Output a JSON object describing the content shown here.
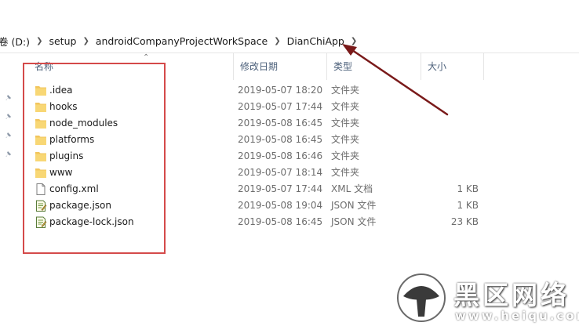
{
  "breadcrumb": [
    {
      "label": "卷 (D:)"
    },
    {
      "label": "setup"
    },
    {
      "label": "androidCompanyProjectWorkSpace"
    },
    {
      "label": "DianChiApp"
    }
  ],
  "columns": {
    "name": "名称",
    "date": "修改日期",
    "type": "类型",
    "size": "大小"
  },
  "files": [
    {
      "name": ".idea",
      "date": "2019-05-07 18:20",
      "type": "文件夹",
      "size": "",
      "icon": "folder-icon"
    },
    {
      "name": "hooks",
      "date": "2019-05-07 17:44",
      "type": "文件夹",
      "size": "",
      "icon": "folder-icon"
    },
    {
      "name": "node_modules",
      "date": "2019-05-08 16:45",
      "type": "文件夹",
      "size": "",
      "icon": "folder-icon"
    },
    {
      "name": "platforms",
      "date": "2019-05-08 16:45",
      "type": "文件夹",
      "size": "",
      "icon": "folder-icon"
    },
    {
      "name": "plugins",
      "date": "2019-05-08 16:46",
      "type": "文件夹",
      "size": "",
      "icon": "folder-icon"
    },
    {
      "name": "www",
      "date": "2019-05-07 18:14",
      "type": "文件夹",
      "size": "",
      "icon": "folder-icon"
    },
    {
      "name": "config.xml",
      "date": "2019-05-07 17:44",
      "type": "XML 文档",
      "size": "1 KB",
      "icon": "xml-file-icon"
    },
    {
      "name": "package.json",
      "date": "2019-05-08 19:04",
      "type": "JSON 文件",
      "size": "1 KB",
      "icon": "json-file-icon"
    },
    {
      "name": "package-lock.json",
      "date": "2019-05-08 16:45",
      "type": "JSON 文件",
      "size": "23 KB",
      "icon": "json-file-icon"
    }
  ],
  "watermark": {
    "brand": "黑区网络",
    "url": "www.heiqu.com"
  },
  "colors": {
    "highlight_box": "#d44a4a",
    "annotation_arrow": "#7a1a1a",
    "folder": "#f2c55c",
    "header_text": "#4c607a"
  }
}
